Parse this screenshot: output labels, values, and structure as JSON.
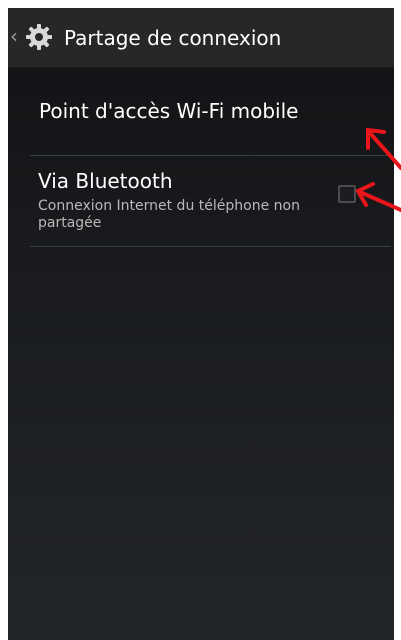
{
  "action_bar": {
    "title": "Partage de connexion",
    "back_glyph": "‹",
    "icon": "settings-gear-icon"
  },
  "settings": {
    "hotspot": {
      "label": "Point d'accès Wi-Fi mobile"
    },
    "bluetooth": {
      "label": "Via Bluetooth",
      "summary": "Connexion Internet du téléphone non partagée",
      "checked": false
    }
  },
  "colors": {
    "annotation_arrow": "#e8161b",
    "background": "#16181b",
    "action_bar": "#262729",
    "divider": "#3a3d41"
  }
}
